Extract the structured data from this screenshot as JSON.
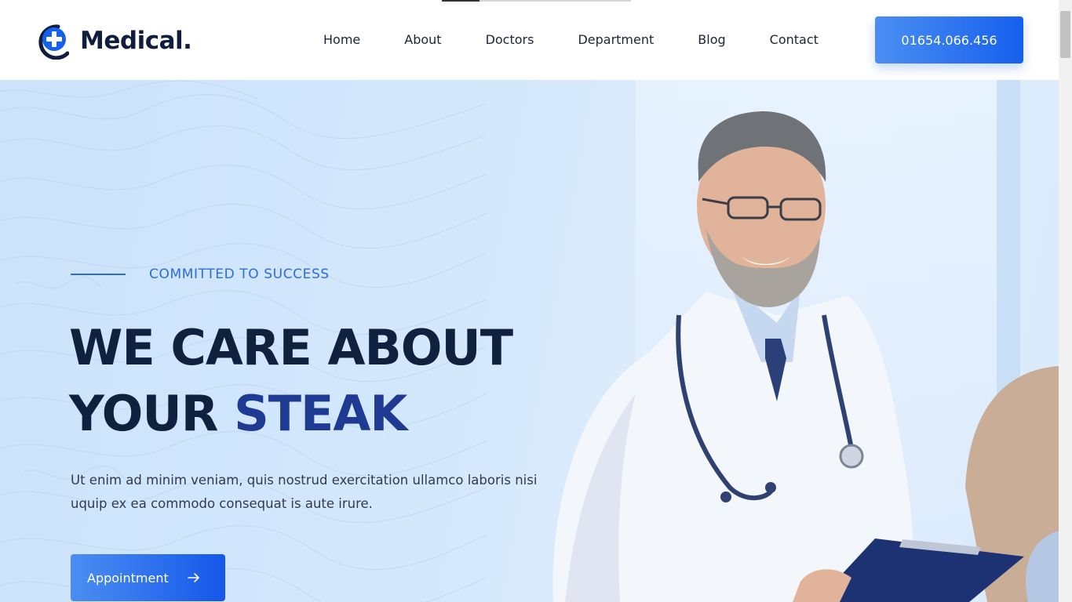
{
  "brand": {
    "name": "Medical.",
    "logo_icon": "medical-cross-icon",
    "primary_color": "#1660ee",
    "dark_color": "#0f1d3f"
  },
  "nav": {
    "items": [
      {
        "label": "Home"
      },
      {
        "label": "About"
      },
      {
        "label": "Doctors"
      },
      {
        "label": "Department"
      },
      {
        "label": "Blog"
      },
      {
        "label": "Contact"
      }
    ]
  },
  "header": {
    "phone": "01654.066.456"
  },
  "hero": {
    "kicker": "COMMITTED TO SUCCESS",
    "headline_line1": "WE CARE ABOUT",
    "headline_line2_prefix": "YOUR",
    "headline_line2_accent": "STEAK",
    "description": "Ut enim ad minim veniam, quis nostrud exercitation ullamco laboris nisi uquip ex ea commodo consequat is aute irure.",
    "button_label": "Appointment",
    "button_icon": "arrow-right-icon",
    "image": "doctor-with-stethoscope-and-clipboard"
  },
  "top_progress": {
    "fraction": 0.2
  }
}
